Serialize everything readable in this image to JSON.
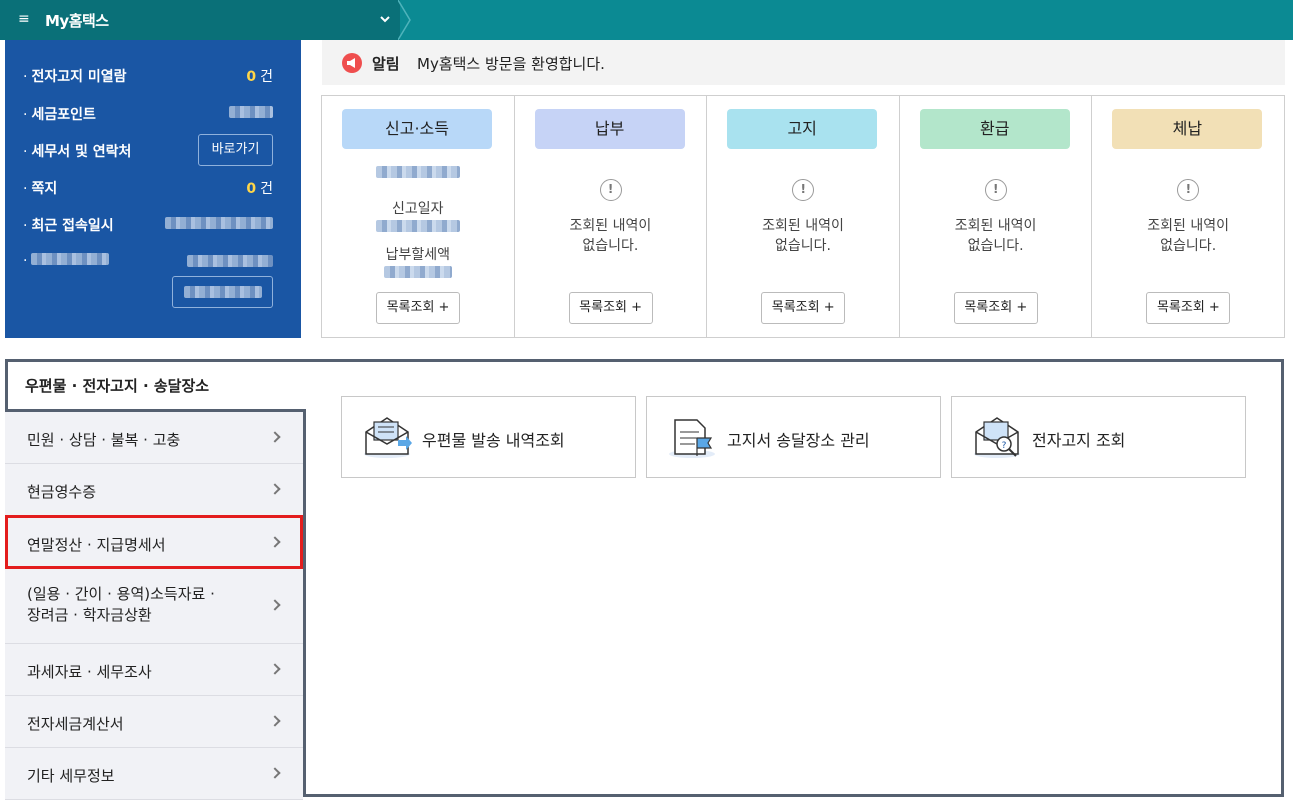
{
  "header": {
    "app_title": "My홈택스",
    "menu_icon": "hamburger-icon",
    "dropdown_icon": "chevron-down-icon"
  },
  "info_panel": {
    "items": [
      {
        "label": "전자고지 미열람",
        "value": "0",
        "unit": "건"
      },
      {
        "label": "세금포인트"
      },
      {
        "label": "세무서 및 연락처",
        "button": "바로가기"
      },
      {
        "label": "쪽지",
        "value": "0",
        "unit": "건"
      },
      {
        "label": "최근 접속일시"
      }
    ]
  },
  "notice": {
    "label": "알림",
    "text": "My홈택스 방문을 환영합니다."
  },
  "cards": [
    {
      "title": "신고·소득",
      "color": "#b8d8f8",
      "line1": "신고일자",
      "line2": "납부할세액",
      "button": "목록조회 +"
    },
    {
      "title": "납부",
      "color": "#c6d3f6",
      "empty1": "조회된 내역이",
      "empty2": "없습니다.",
      "button": "목록조회 +"
    },
    {
      "title": "고지",
      "color": "#a9e2ef",
      "empty1": "조회된 내역이",
      "empty2": "없습니다.",
      "button": "목록조회 +"
    },
    {
      "title": "환급",
      "color": "#b3e6cb",
      "empty1": "조회된 내역이",
      "empty2": "없습니다.",
      "button": "목록조회 +"
    },
    {
      "title": "체납",
      "color": "#f2e0b6",
      "empty1": "조회된 내역이",
      "empty2": "없습니다.",
      "button": "목록조회 +"
    }
  ],
  "lower": {
    "tab_title": "우편물 · 전자고지 · 송달장소",
    "side_menu": [
      {
        "label": "민원 · 상담 · 불복 · 고충"
      },
      {
        "label": "현금영수증"
      },
      {
        "label": "연말정산 · 지급명세서"
      },
      {
        "label": "(일용 · 간이 · 용역)소득자료 ·",
        "label2": "장려금 · 학자금상환"
      },
      {
        "label": "과세자료 · 세무조사"
      },
      {
        "label": "전자세금계산서"
      },
      {
        "label": "기타 세무정보"
      }
    ],
    "services": [
      {
        "label": "우편물 발송 내역조회",
        "icon": "mail-send-icon"
      },
      {
        "label": "고지서 송달장소 관리",
        "icon": "document-flag-icon"
      },
      {
        "label": "전자고지 조회",
        "icon": "mail-search-icon"
      }
    ]
  }
}
